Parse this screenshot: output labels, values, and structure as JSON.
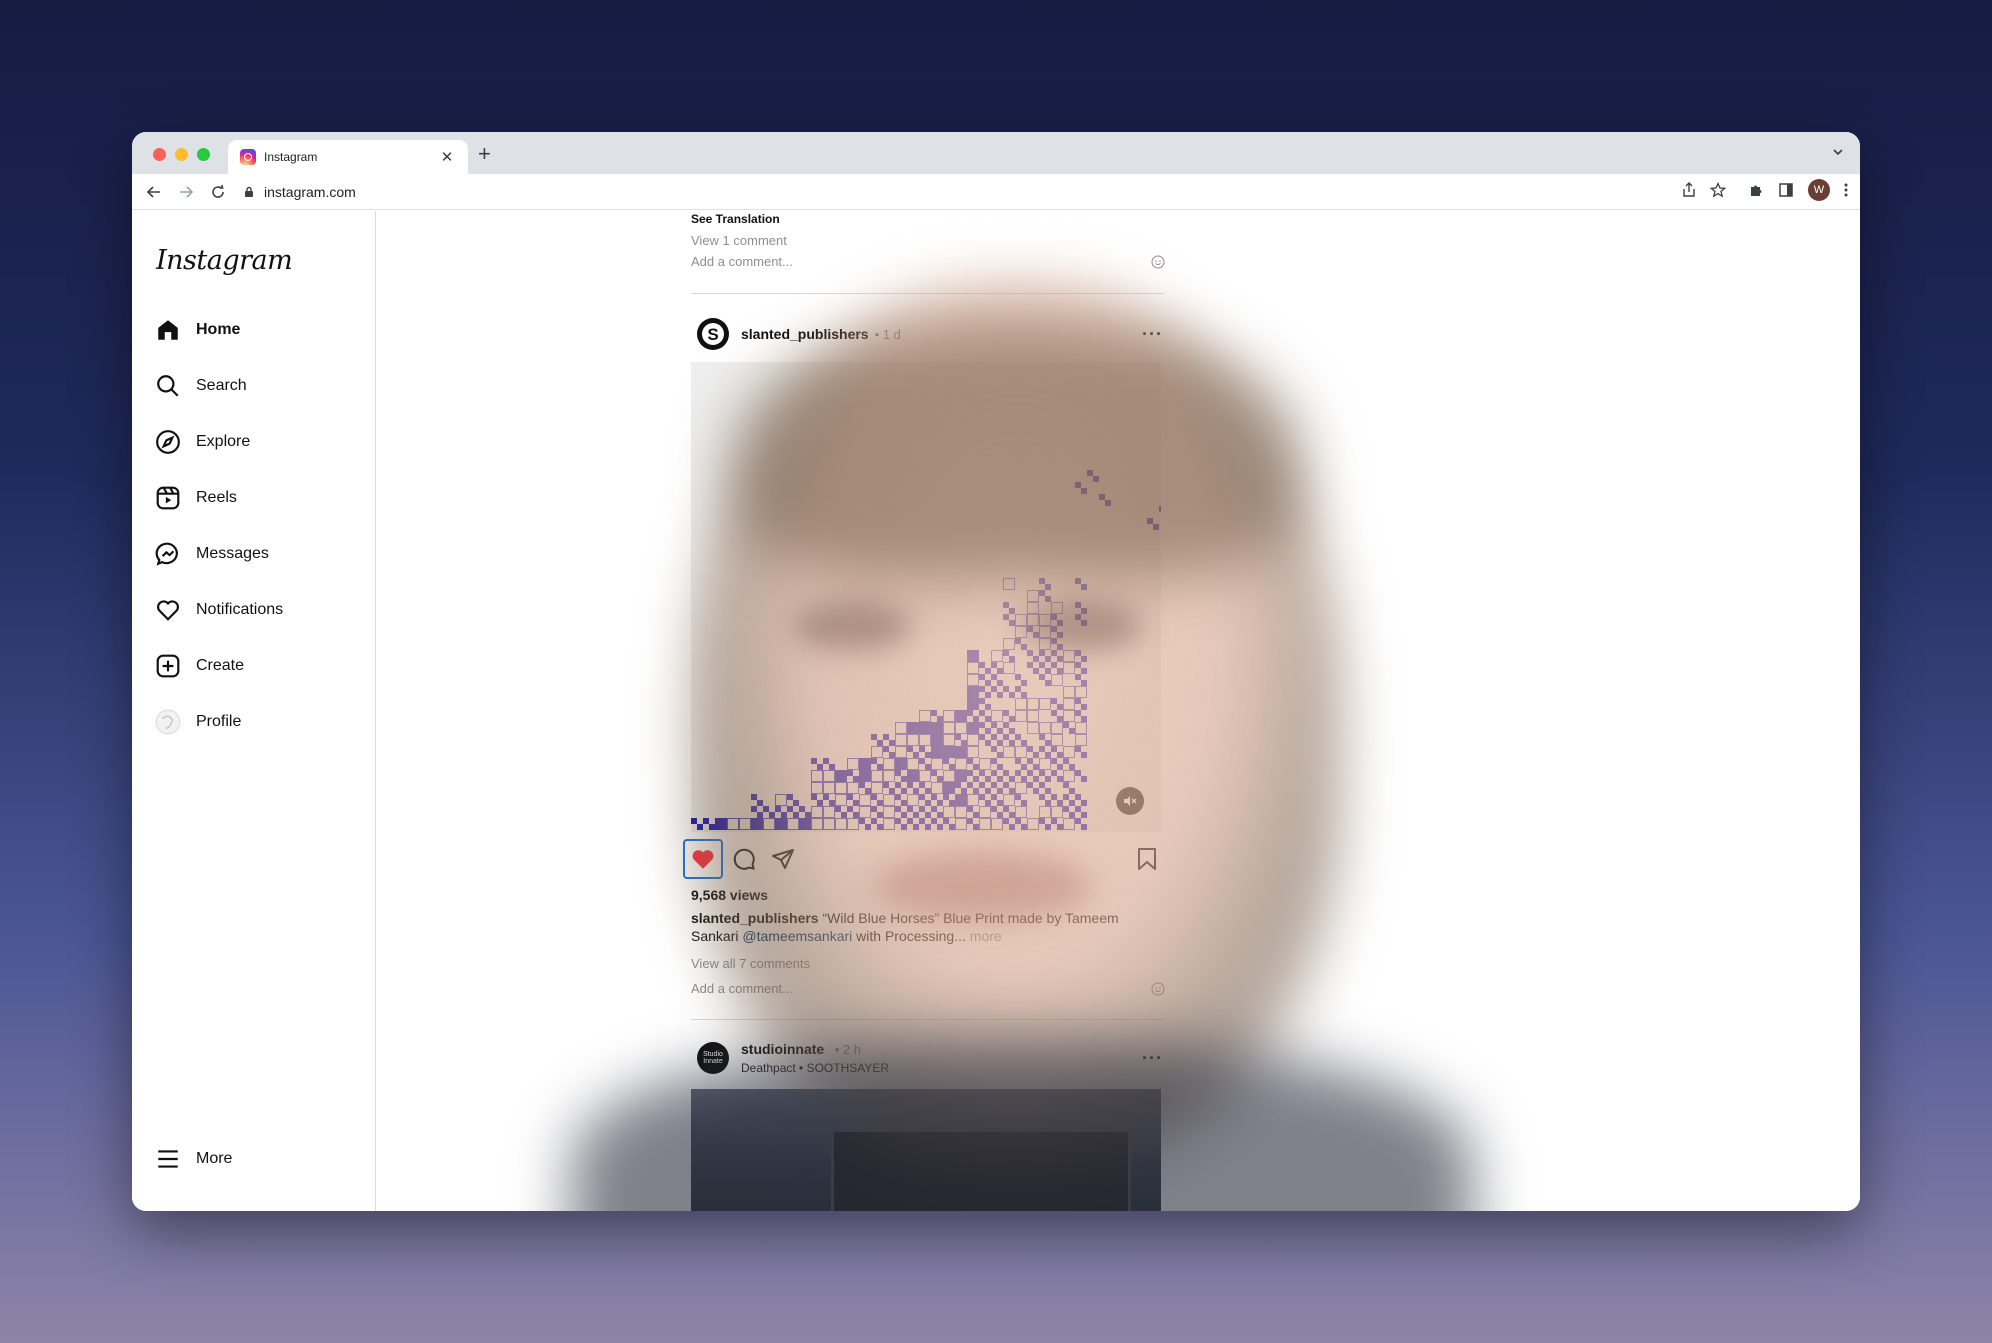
{
  "browser": {
    "tab_title": "Instagram",
    "url": "instagram.com",
    "profile_initial": "W",
    "new_tab_label": "+",
    "close_label": "✕"
  },
  "sidebar": {
    "logo": "Instagram",
    "items": [
      {
        "label": "Home",
        "icon": "home-icon"
      },
      {
        "label": "Search",
        "icon": "search-icon"
      },
      {
        "label": "Explore",
        "icon": "compass-icon"
      },
      {
        "label": "Reels",
        "icon": "reels-icon"
      },
      {
        "label": "Messages",
        "icon": "messenger-icon"
      },
      {
        "label": "Notifications",
        "icon": "heart-icon"
      },
      {
        "label": "Create",
        "icon": "plus-square-icon"
      },
      {
        "label": "Profile",
        "icon": "avatar"
      }
    ],
    "more_label": "More"
  },
  "feed": {
    "prev_post": {
      "see_translation": "See Translation",
      "view_comments": "View 1 comment",
      "add_comment": "Add a comment..."
    },
    "post": {
      "username": "slanted_publishers",
      "time": "• 1 d",
      "avatar_letter": "S",
      "views": "9,568 views",
      "caption_user": "slanted_publishers",
      "caption_text_1": " “Wild Blue Horses” Blue Print made by Tameem Sankari ",
      "caption_mention": "@tameemsankari",
      "caption_text_2": " with Processing...",
      "caption_more": " more",
      "view_comments": "View all 7 comments",
      "add_comment": "Add a comment...",
      "liked": true,
      "pattern_color": "#1010b8"
    },
    "next_post": {
      "username": "studioinnate",
      "time": "• 2 h",
      "avatar_text": "Studio Innate",
      "subtitle": "Deathpact • SOOTHSAYER"
    }
  },
  "colors": {
    "like_red": "#ff3040",
    "focus_blue": "#1a73e8"
  }
}
